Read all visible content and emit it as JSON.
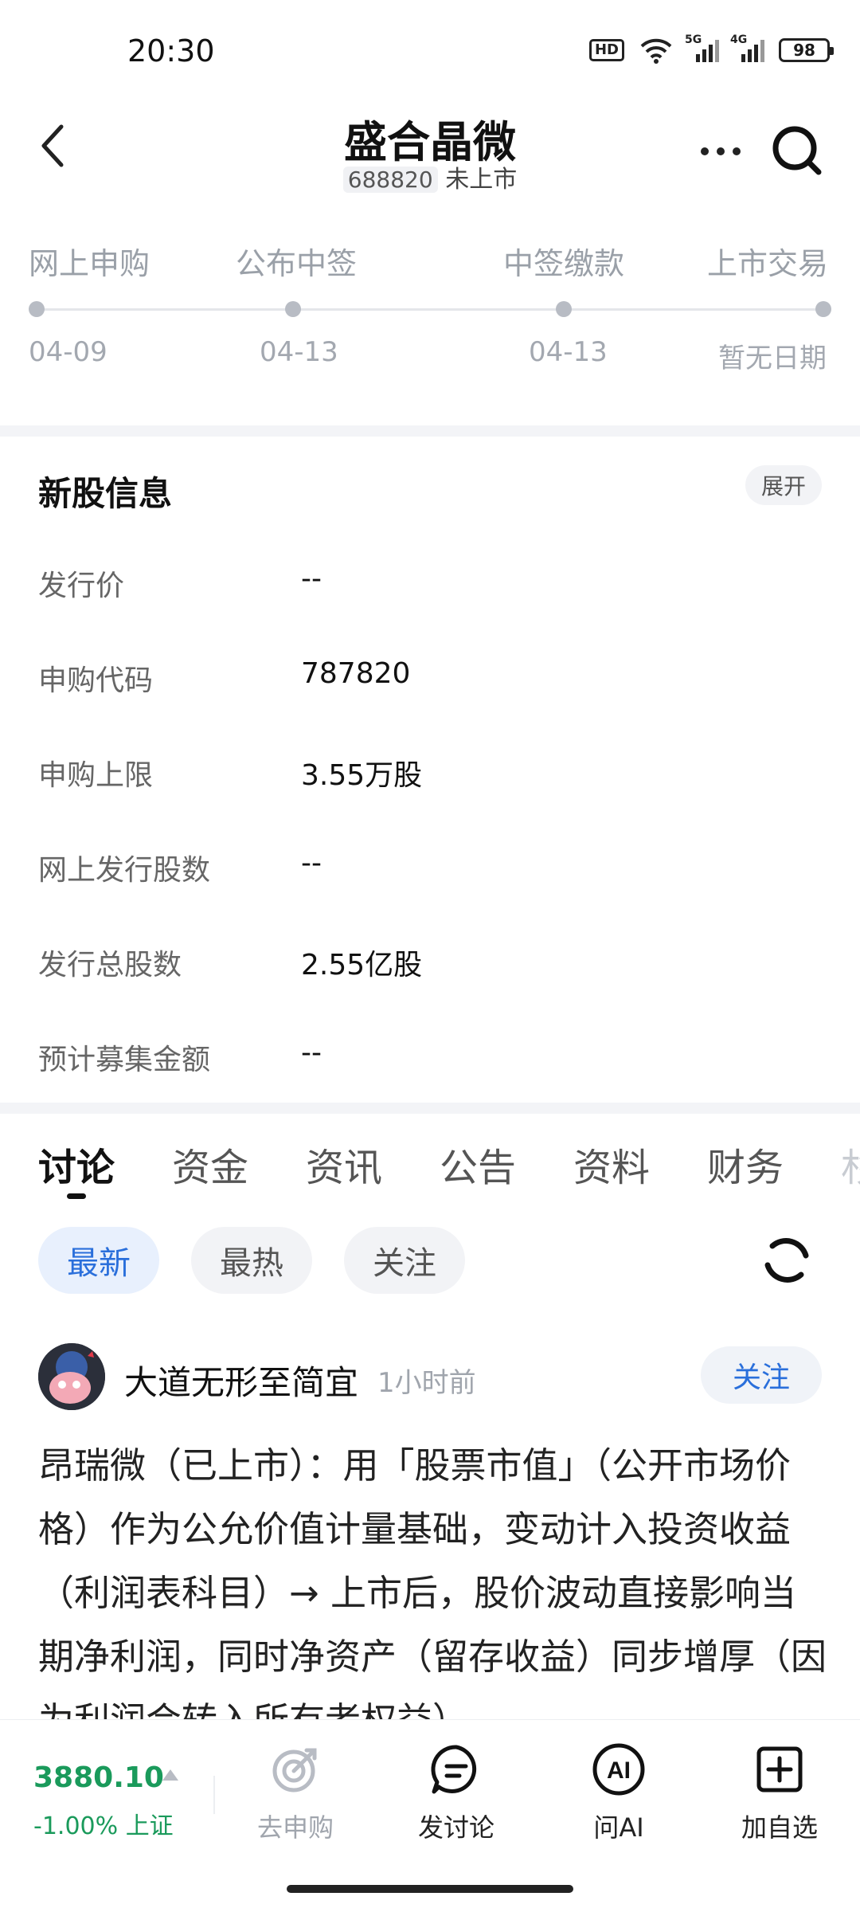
{
  "status_bar": {
    "time": "20:30",
    "hd_label": "HD",
    "network_1": "5G",
    "network_2": "4G",
    "battery": "98"
  },
  "header": {
    "title": "盛合晶微",
    "stock_code": "688820",
    "status": "未上市"
  },
  "timeline": [
    {
      "label": "网上申购",
      "date": "04-09"
    },
    {
      "label": "公布中签",
      "date": "04-13"
    },
    {
      "label": "中签缴款",
      "date": "04-13"
    },
    {
      "label": "上市交易",
      "date": "暂无日期"
    }
  ],
  "info": {
    "title": "新股信息",
    "expand_label": "展开",
    "rows": [
      {
        "key": "发行价",
        "value": "--"
      },
      {
        "key": "申购代码",
        "value": "787820"
      },
      {
        "key": "申购上限",
        "value": "3.55万股"
      },
      {
        "key": "网上发行股数",
        "value": "--"
      },
      {
        "key": "发行总股数",
        "value": "2.55亿股"
      },
      {
        "key": "预计募集金额",
        "value": "--"
      }
    ]
  },
  "tabs": [
    "讨论",
    "资金",
    "资讯",
    "公告",
    "资料",
    "财务",
    "杉"
  ],
  "filters": [
    "最新",
    "最热",
    "关注"
  ],
  "post": {
    "author": "大道无形至简宜",
    "time": "1小时前",
    "follow_label": "关注",
    "body": "昂瑞微（已上市）：用「股票市值」（公开市场价格）作为公允价值计量基础，变动计入投资收益（利润表科目）→ 上市后，股价波动直接影响当期净利润，同时净资产（留存收益）同步增厚（因为利润会转入所有者权益）"
  },
  "bottom_bar": {
    "index_value": "3880.10",
    "index_change": "-1.00%",
    "index_name": "上证",
    "items": [
      {
        "label": "去申购",
        "icon": "target-icon"
      },
      {
        "label": "发讨论",
        "icon": "chat-icon"
      },
      {
        "label": "问AI",
        "icon": "ai-icon"
      },
      {
        "label": "加自选",
        "icon": "add-box-icon"
      }
    ]
  },
  "colors": {
    "accent_blue": "#2a6fdb",
    "index_green": "#1a9a5b"
  }
}
